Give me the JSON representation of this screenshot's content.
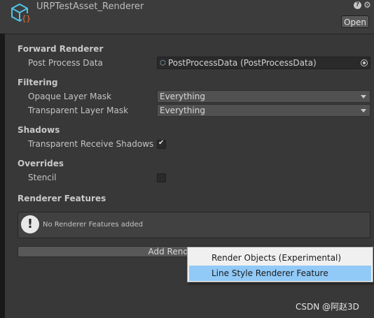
{
  "header": {
    "title": "URPTestAsset_Renderer",
    "open_label": "Open",
    "help_icon": "help-icon",
    "settings_icon": "gear-icon",
    "help_glyph": "?",
    "settings_glyph": "⚙"
  },
  "forward_renderer": {
    "section": "Forward Renderer",
    "post_process_label": "Post Process Data",
    "post_process_value": "PostProcessData (PostProcessData)"
  },
  "filtering": {
    "section": "Filtering",
    "opaque_label": "Opaque Layer Mask",
    "opaque_value": "Everything",
    "transparent_label": "Transparent Layer Mask",
    "transparent_value": "Everything"
  },
  "shadows": {
    "section": "Shadows",
    "receive_label": "Transparent Receive Shadows",
    "receive_checked": true,
    "check_glyph": "✔"
  },
  "overrides": {
    "section": "Overrides",
    "stencil_label": "Stencil",
    "stencil_checked": false
  },
  "renderer_features": {
    "section": "Renderer Features",
    "empty_message": "No Renderer Features added",
    "warn_glyph": "!",
    "add_button_label": "Add Renderer Feature"
  },
  "popup_menu": {
    "items": [
      {
        "label": "Render Objects (Experimental)",
        "highlighted": false
      },
      {
        "label": "Line Style Renderer Feature",
        "highlighted": true
      }
    ]
  },
  "watermark": "CSDN @阿赵3D",
  "colors": {
    "panel_bg": "#383838",
    "menu_highlight": "#91c9f7",
    "asset_icon": "#4fc3e8",
    "asset_icon_badge": "#e87040"
  }
}
